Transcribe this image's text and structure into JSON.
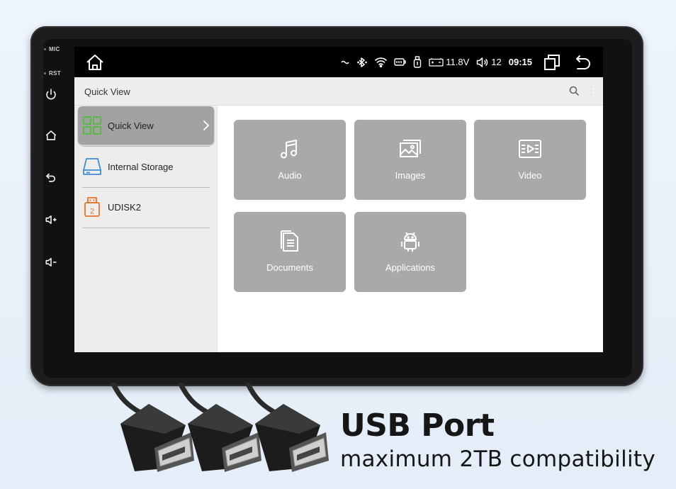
{
  "device": {
    "mic_label": "MIC",
    "rst_label": "RST"
  },
  "statusbar": {
    "voltage": "11.8V",
    "volume": "12",
    "time": "09:15"
  },
  "titlebar": {
    "title": "Quick View"
  },
  "sidebar": {
    "items": [
      {
        "label": "Quick View",
        "icon": "grid-icon",
        "active": true
      },
      {
        "label": "Internal Storage",
        "icon": "storage-icon",
        "active": false
      },
      {
        "label": "UDISK2",
        "icon": "usb-disk-icon",
        "badge": "2",
        "active": false
      }
    ]
  },
  "tiles": [
    {
      "label": "Audio",
      "icon": "music-note-icon"
    },
    {
      "label": "Images",
      "icon": "images-icon"
    },
    {
      "label": "Video",
      "icon": "video-icon"
    },
    {
      "label": "Documents",
      "icon": "documents-icon"
    },
    {
      "label": "Applications",
      "icon": "android-icon"
    }
  ],
  "banner": {
    "title": "USB Port",
    "subtitle": "maximum 2TB compatibility"
  },
  "colors": {
    "active_item": "#a2a2a2",
    "tile": "#a9a9a9",
    "quickview_icon": "#59b947",
    "storage_icon": "#3f8fd8",
    "udisk_icon": "#e0742d"
  }
}
